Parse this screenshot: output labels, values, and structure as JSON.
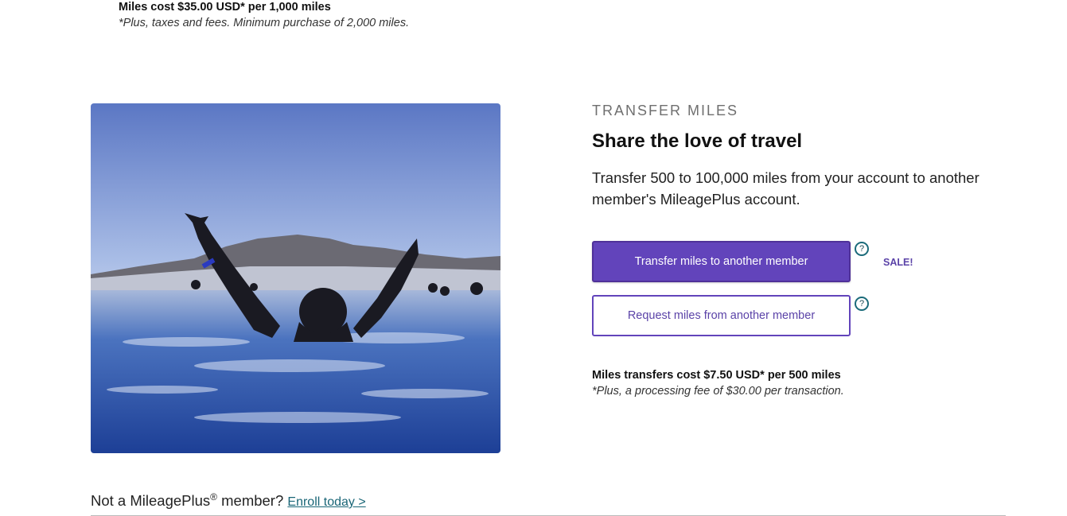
{
  "buy_section": {
    "cost_text": "Miles cost $35.00 USD* per 1,000 miles",
    "note_text": "*Plus, taxes and fees. Minimum purchase of 2,000 miles."
  },
  "transfer_section": {
    "eyebrow": "TRANSFER MILES",
    "headline": "Share the love of travel",
    "description": "Transfer 500 to 100,000 miles from your account to another member's MileagePlus account.",
    "primary_button": "Transfer miles to another member",
    "secondary_button": "Request miles from another member",
    "help_icon": "?",
    "sale_badge": "SALE!",
    "cost_text": "Miles transfers cost $7.50 USD* per 500 miles",
    "note_text": "*Plus, a processing fee of $30.00 per transaction.",
    "image_icon": "photo-swimmer-hot-spring"
  },
  "enroll": {
    "prefix": "Not a MileagePlus",
    "registered": "®",
    "suffix": " member? ",
    "link": "Enroll today >"
  },
  "colors": {
    "accent_purple": "#6244bb",
    "help_teal": "#1b6b7a",
    "link_teal": "#1a6677"
  }
}
